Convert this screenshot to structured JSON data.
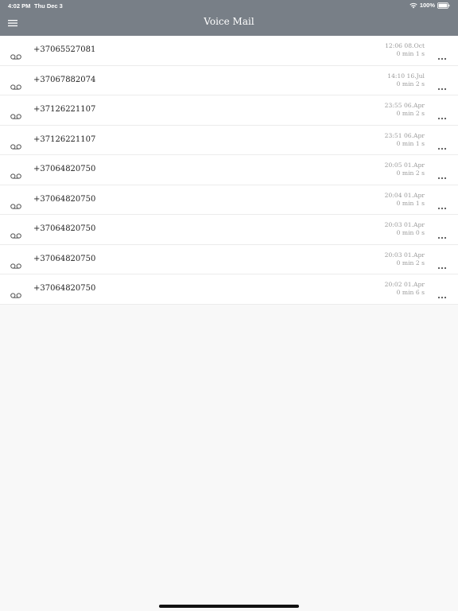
{
  "status_bar": {
    "time": "4:02 PM",
    "date": "Thu Dec 3",
    "battery": "100%"
  },
  "header": {
    "title": "Voice Mail",
    "menu_icon": "hamburger-menu-icon"
  },
  "colors": {
    "header_bg": "#787f87",
    "meta_text": "#9a9a9a",
    "icon": "#555555"
  },
  "voicemails": [
    {
      "number": "+37065527081",
      "datetime": "12:06 08.Oct",
      "duration": "0 min 1 s"
    },
    {
      "number": "+37067882074",
      "datetime": "14:10 16.Jul",
      "duration": "0 min 2 s"
    },
    {
      "number": "+37126221107",
      "datetime": "23:55 06.Apr",
      "duration": "0 min 2 s"
    },
    {
      "number": "+37126221107",
      "datetime": "23:51 06.Apr",
      "duration": "0 min 1 s"
    },
    {
      "number": "+37064820750",
      "datetime": "20:05 01.Apr",
      "duration": "0 min 2 s"
    },
    {
      "number": "+37064820750",
      "datetime": "20:04 01.Apr",
      "duration": "0 min 1 s"
    },
    {
      "number": "+37064820750",
      "datetime": "20:03 01.Apr",
      "duration": "0 min 0 s"
    },
    {
      "number": "+37064820750",
      "datetime": "20:03 01.Apr",
      "duration": "0 min 2 s"
    },
    {
      "number": "+37064820750",
      "datetime": "20:02 01.Apr",
      "duration": "0 min 6 s"
    }
  ]
}
